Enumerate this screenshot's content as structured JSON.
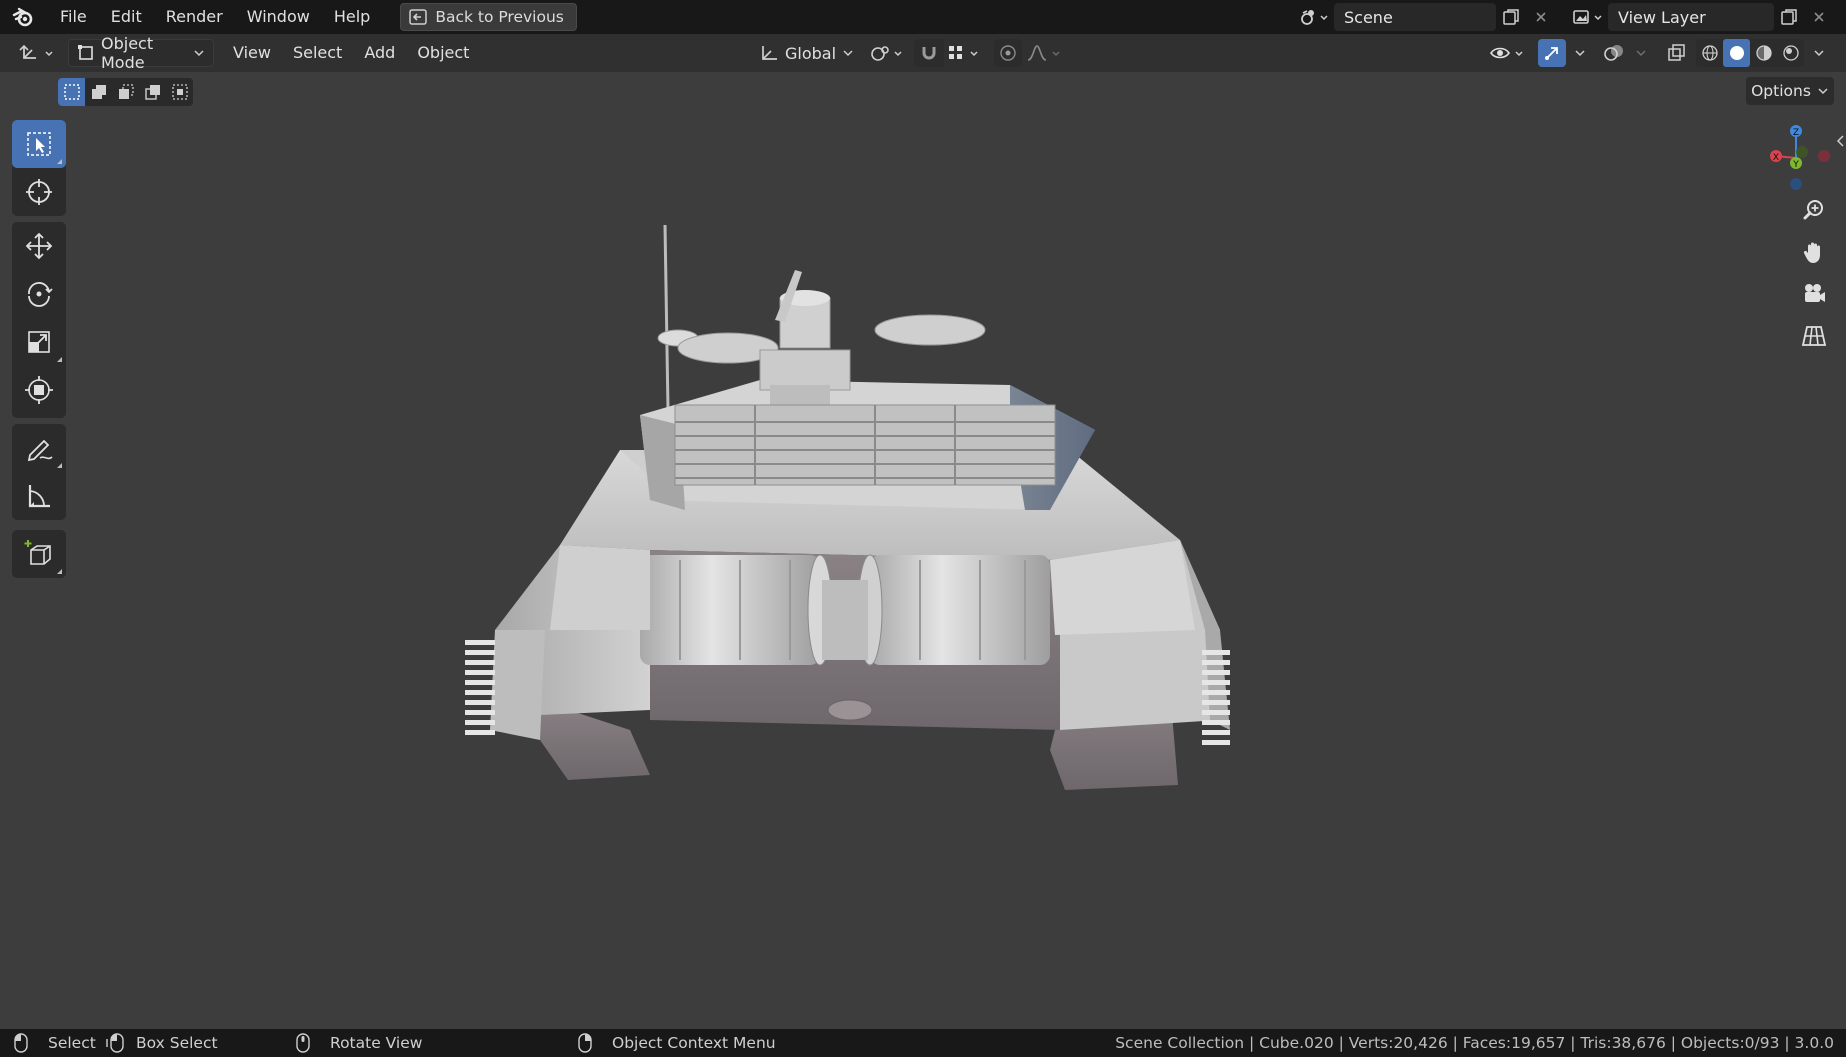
{
  "topbar": {
    "menu": [
      "File",
      "Edit",
      "Render",
      "Window",
      "Help"
    ],
    "back_button": "Back to Previous",
    "scene_name": "Scene",
    "view_layer": "View Layer"
  },
  "header": {
    "mode": "Object Mode",
    "menus": [
      "View",
      "Select",
      "Add",
      "Object"
    ],
    "orientation": "Global"
  },
  "tool_header": {
    "options": "Options"
  },
  "status": {
    "select": "Select",
    "box_select": "Box Select",
    "rotate_view": "Rotate View",
    "context_menu": "Object Context Menu",
    "stats": "Scene Collection | Cube.020 | Verts:20,426 | Faces:19,657 | Tris:38,676 | Objects:0/93 | 3.0.0"
  },
  "colors": {
    "accent": "#4772b3",
    "viewport_bg": "#3d3d3d",
    "axis_x": "#d9424f",
    "axis_y": "#7fb82e",
    "axis_z": "#3d8ae0"
  }
}
